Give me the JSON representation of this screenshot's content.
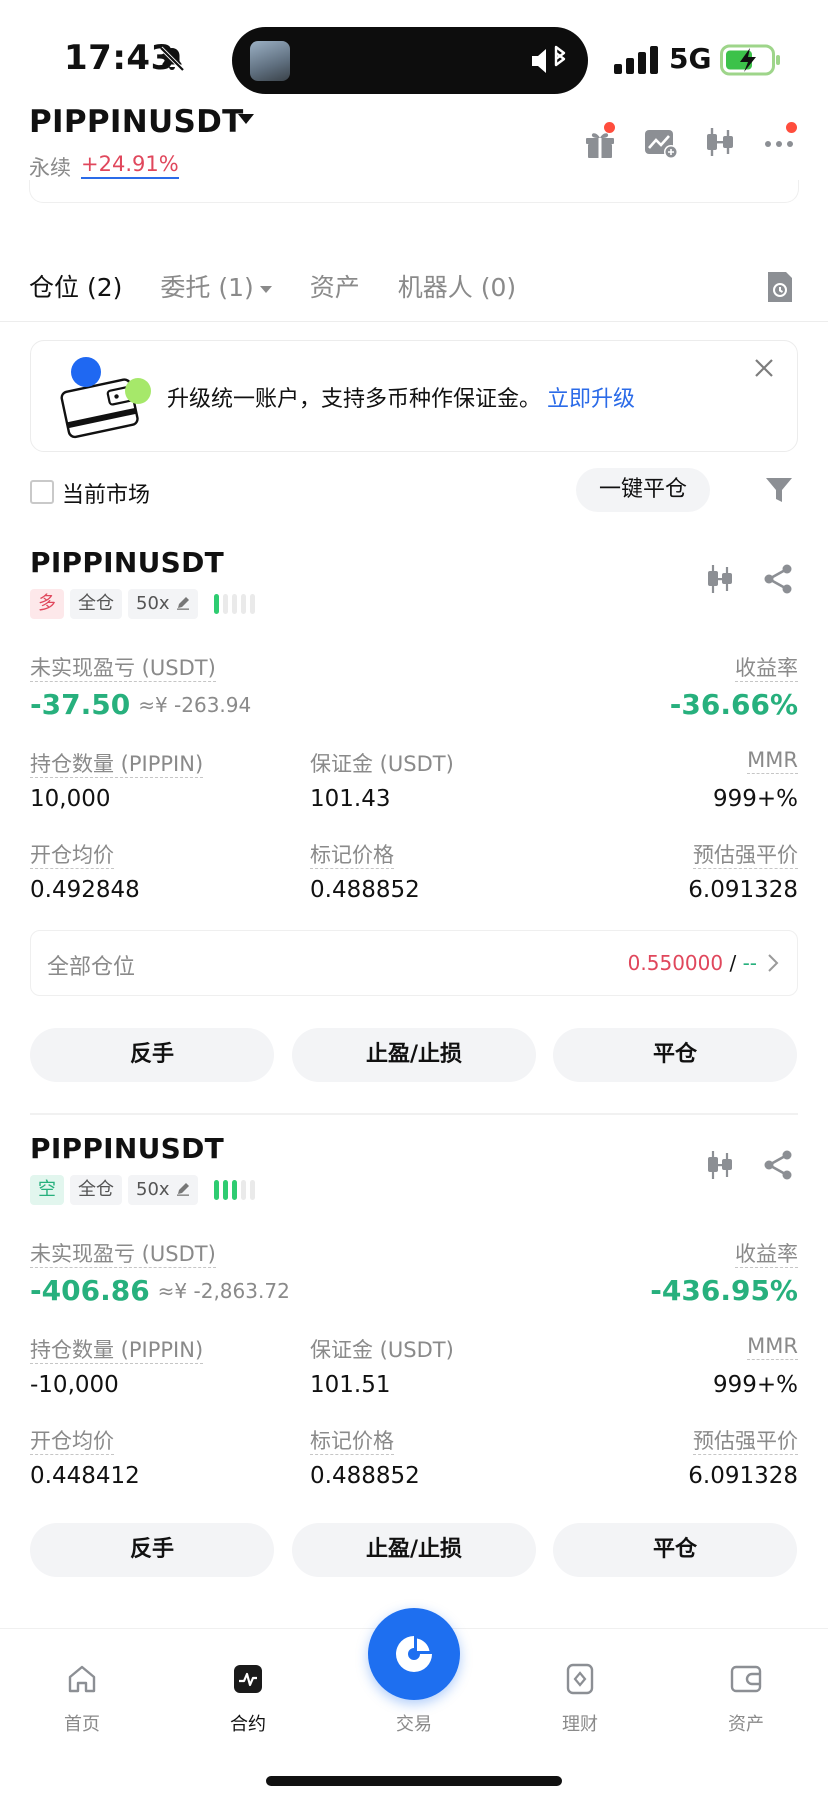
{
  "status_bar": {
    "time": "17:43",
    "network": "5G",
    "icons": [
      "bell-muted-icon",
      "speaker-icon",
      "bluetooth-icon",
      "signal-icon",
      "battery-charging-icon"
    ]
  },
  "header": {
    "pair": "PIPPINUSDT",
    "market_type": "永续",
    "change": "+24.91%",
    "icons": [
      "gift-icon",
      "chart-swap-icon",
      "candlestick-icon",
      "more-icon"
    ]
  },
  "tabs": [
    {
      "label": "仓位 (2)",
      "active": true
    },
    {
      "label": "委托 (1)",
      "has_dropdown": true
    },
    {
      "label": "资产"
    },
    {
      "label": "机器人 (0)"
    }
  ],
  "banner": {
    "text": "升级统一账户，支持多币种作保证金。",
    "link": "立即升级"
  },
  "filters": {
    "current_market_label": "当前市场",
    "current_market_checked": false,
    "close_all": "一键平仓"
  },
  "positions": [
    {
      "symbol": "PIPPINUSDT",
      "side": "多",
      "margin_mode": "全仓",
      "leverage": "50x",
      "adl_level": 1,
      "unrealized_label": "未实现盈亏 (USDT)",
      "unrealized": "-37.50",
      "unrealized_cny": "≈¥ -263.94",
      "roe_label": "收益率",
      "roe": "-36.66%",
      "size_label": "持仓数量 (PIPPIN)",
      "size": "10,000",
      "margin_label": "保证金 (USDT)",
      "margin": "101.43",
      "mmr_label": "MMR",
      "mmr": "999+%",
      "entry_label": "开仓均价",
      "entry": "0.492848",
      "mark_label": "标记价格",
      "mark": "0.488852",
      "liq_label": "预估强平价",
      "liq": "6.091328",
      "all_positions_label": "全部仓位",
      "all_positions_value": "0.550000",
      "all_positions_slash": "/",
      "all_positions_dash": "--",
      "actions": [
        "反手",
        "止盈/止损",
        "平仓"
      ]
    },
    {
      "symbol": "PIPPINUSDT",
      "side": "空",
      "margin_mode": "全仓",
      "leverage": "50x",
      "adl_level": 3,
      "unrealized_label": "未实现盈亏 (USDT)",
      "unrealized": "-406.86",
      "unrealized_cny": "≈¥ -2,863.72",
      "roe_label": "收益率",
      "roe": "-436.95%",
      "size_label": "持仓数量 (PIPPIN)",
      "size": "-10,000",
      "margin_label": "保证金 (USDT)",
      "margin": "101.51",
      "mmr_label": "MMR",
      "mmr": "999+%",
      "entry_label": "开仓均价",
      "entry": "0.448412",
      "mark_label": "标记价格",
      "mark": "0.488852",
      "liq_label": "预估强平价",
      "liq": "6.091328",
      "actions": [
        "反手",
        "止盈/止损",
        "平仓"
      ]
    }
  ],
  "bottom_nav": [
    {
      "label": "首页",
      "icon": "home-icon"
    },
    {
      "label": "合约",
      "icon": "futures-icon",
      "active": true
    },
    {
      "label": "交易",
      "icon": "trade-icon"
    },
    {
      "label": "理财",
      "icon": "earn-icon"
    },
    {
      "label": "资产",
      "icon": "wallet-icon"
    }
  ],
  "colors": {
    "accent_blue": "#1e6ff0",
    "up_red": "#e0475c",
    "down_green": "#27b07d",
    "liq_orange": "#f19a4b"
  }
}
